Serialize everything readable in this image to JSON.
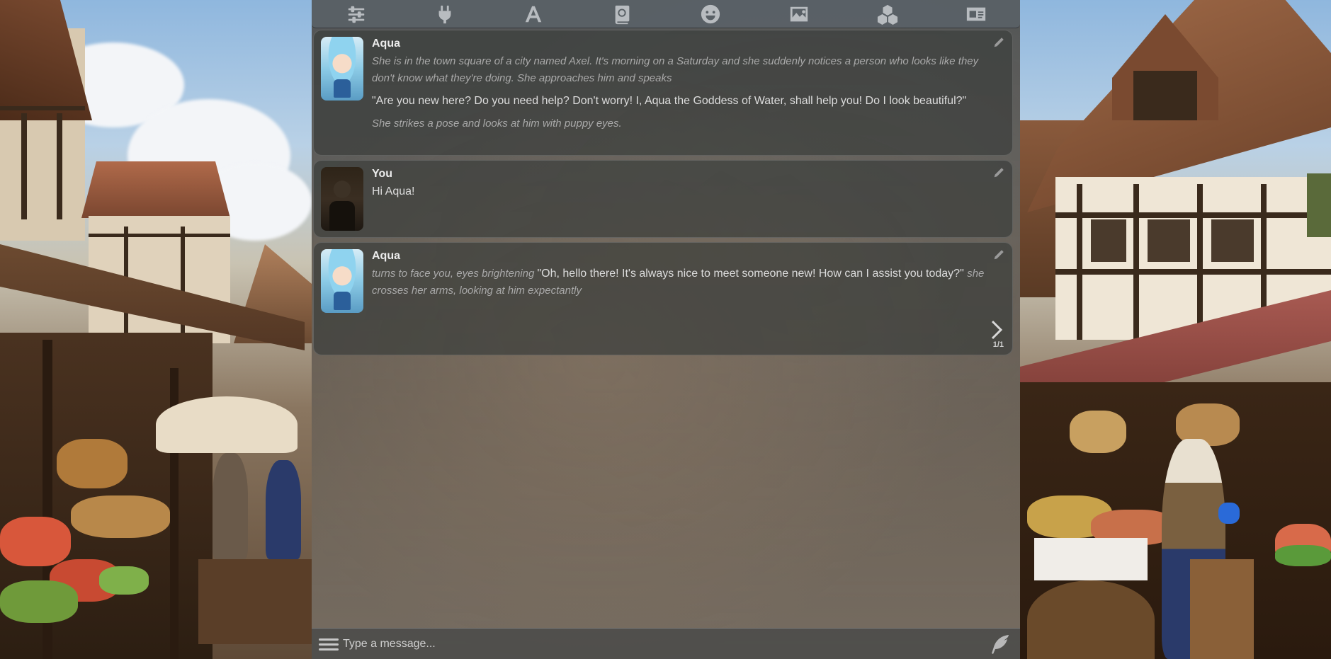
{
  "toolbar": {
    "icons": [
      {
        "name": "sliders-icon"
      },
      {
        "name": "plug-icon"
      },
      {
        "name": "font-icon"
      },
      {
        "name": "book-icon"
      },
      {
        "name": "smile-icon"
      },
      {
        "name": "image-icon"
      },
      {
        "name": "cubes-icon"
      },
      {
        "name": "id-card-icon"
      }
    ]
  },
  "messages": [
    {
      "name": "Aqua",
      "avatar": "aqua",
      "paragraphs": [
        {
          "style": "narration",
          "text": "She is in the town square of a city named Axel. It's morning on a Saturday and she suddenly notices a person who looks like they don't know what they're doing. She approaches him and speaks"
        },
        {
          "style": "speech",
          "text": "\"Are you new here? Do you need help? Don't worry! I, Aqua the Goddess of Water, shall help you! Do I look beautiful?\""
        },
        {
          "style": "narration",
          "text": "She strikes a pose and looks at him with puppy eyes."
        }
      ]
    },
    {
      "name": "You",
      "avatar": "you",
      "paragraphs": [
        {
          "style": "speech",
          "text": "Hi Aqua!"
        }
      ]
    },
    {
      "name": "Aqua",
      "avatar": "aqua",
      "segments": [
        {
          "style": "narration",
          "text": "turns to face you, eyes brightening "
        },
        {
          "style": "speech",
          "text": "\"Oh, hello there! It's always nice to meet someone new! How can I assist you today?\" "
        },
        {
          "style": "narration",
          "text": "she crosses her arms, looking at him expectantly"
        }
      ],
      "swipe_counter": "1/1"
    }
  ],
  "input": {
    "placeholder": "Type a message...",
    "value": ""
  }
}
